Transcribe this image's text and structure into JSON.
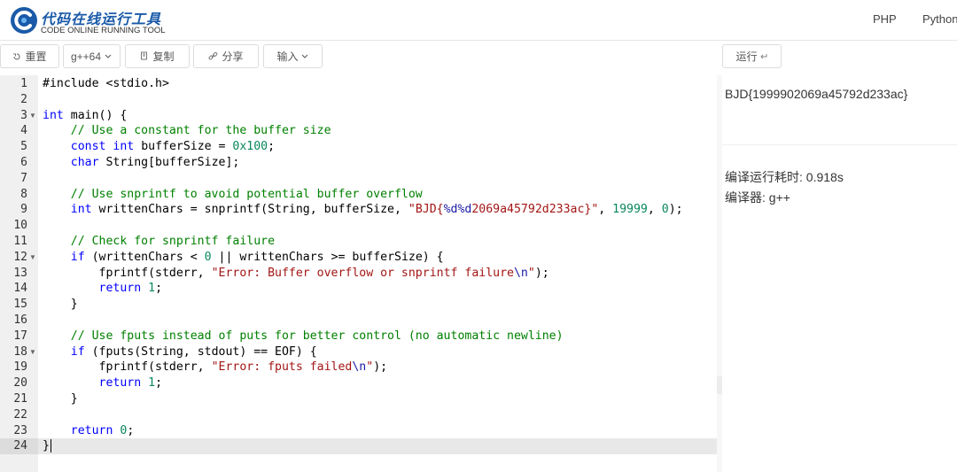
{
  "brand": {
    "title": "代码在线运行工具",
    "subtitle": "CODE ONLINE RUNNING TOOL",
    "logo_icon": "cloud-c-logo",
    "accent": "#1a5aa8"
  },
  "nav": [
    "PHP",
    "Python"
  ],
  "toolbar": {
    "reset": "重置",
    "compiler": "g++64",
    "copy": "复制",
    "share": "分享",
    "input": "输入",
    "run": "运行"
  },
  "editor": {
    "lines": [
      "#include <stdio.h>",
      "",
      "int main() {",
      "    // Use a constant for the buffer size",
      "    const int bufferSize = 0x100;",
      "    char String[bufferSize];",
      "",
      "    // Use snprintf to avoid potential buffer overflow",
      "    int writtenChars = snprintf(String, bufferSize, \"BJD{%d%d2069a45792d233ac}\", 19999, 0);",
      "",
      "    // Check for snprintf failure",
      "    if (writtenChars < 0 || writtenChars >= bufferSize) {",
      "        fprintf(stderr, \"Error: Buffer overflow or snprintf failure\\n\");",
      "        return 1;",
      "    }",
      "",
      "    // Use fputs instead of puts for better control (no automatic newline)",
      "    if (fputs(String, stdout) == EOF) {",
      "        fprintf(stderr, \"Error: fputs failed\\n\");",
      "        return 1;",
      "    }",
      "",
      "    return 0;",
      "}"
    ],
    "fold_lines": [
      3,
      12,
      18
    ],
    "active_line": 24
  },
  "output": {
    "result": "BJD{1999902069a45792d233ac}",
    "time_label": "编译运行耗时: 0.918s",
    "compiler_label": "编译器: g++"
  }
}
